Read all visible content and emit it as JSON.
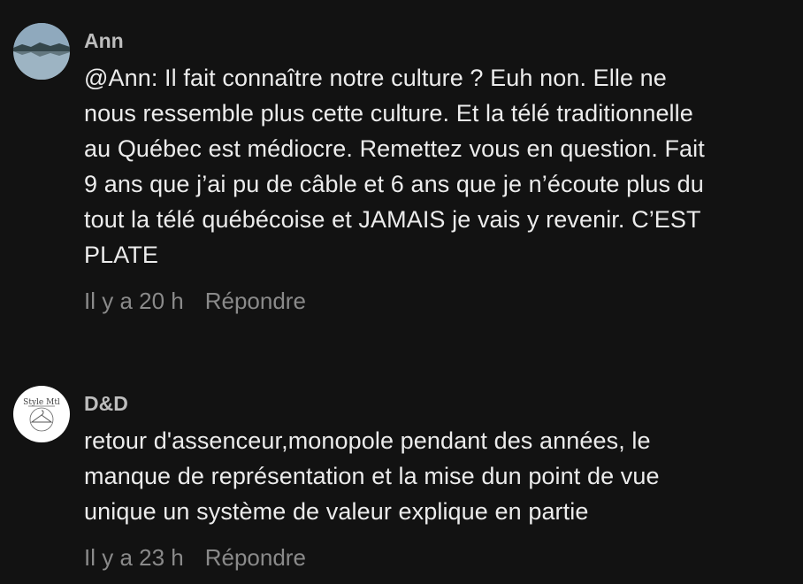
{
  "comments": [
    {
      "username": "Ann",
      "avatar": "lake-landscape-avatar",
      "text_lines": [
        "@Ann: Il fait connaître notre culture ? Euh non. Elle ne",
        "nous ressemble plus cette culture. Et la télé traditionnelle",
        "au Québec est médiocre. Remettez vous en question. Fait",
        "9 ans que j’ai pu de câble et 6 ans que je n’écoute plus du",
        "tout la télé québécoise et JAMAIS je vais y revenir. C’EST",
        "PLATE"
      ],
      "timestamp": "Il y a 20 h",
      "reply_label": "Répondre"
    },
    {
      "username": "D&D",
      "avatar": "style-mtl-logo-avatar",
      "avatar_text": "Style Mtl",
      "text_lines": [
        "retour d'assenceur,monopole pendant des années, le",
        "manque de représentation et la mise dun point de vue",
        "unique un système de valeur explique en partie"
      ],
      "timestamp": "Il y a 23 h",
      "reply_label": "Répondre"
    }
  ]
}
